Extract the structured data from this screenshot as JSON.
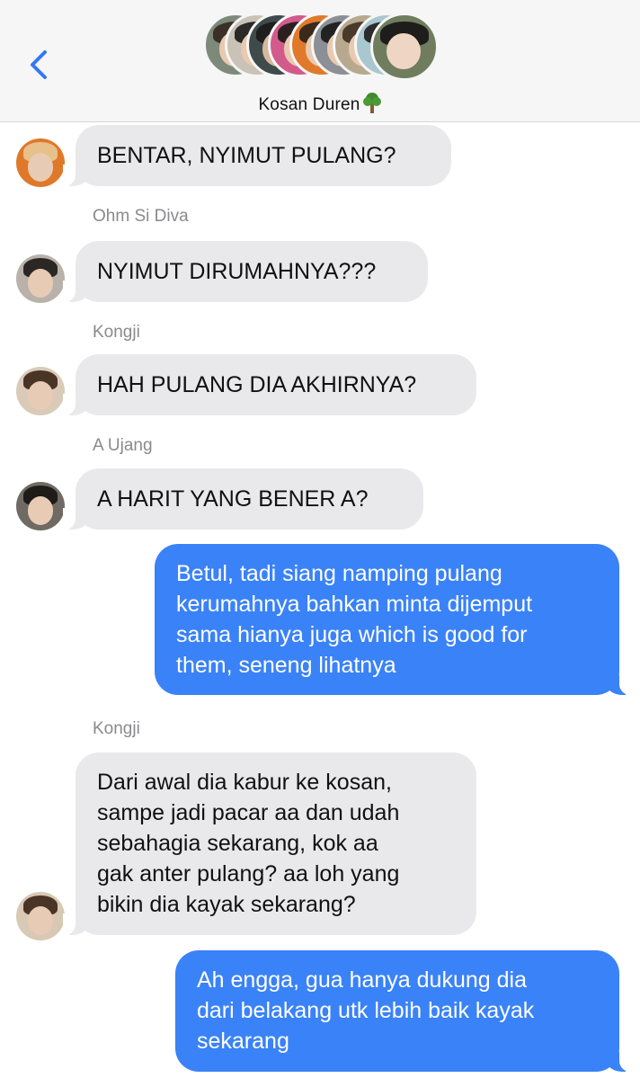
{
  "header": {
    "back_icon": "chevron-left-icon",
    "group_name": "Kosan Duren",
    "group_emoji": "tree-icon",
    "accent_color": "#3478f6"
  },
  "messages": [
    {
      "direction": "incoming",
      "sender": "",
      "text": [
        "BENTAR, NYIMUT PULANG?"
      ]
    },
    {
      "direction": "incoming",
      "sender": "Ohm Si Diva",
      "text": [
        "NYIMUT DIRUMAHNYA???"
      ]
    },
    {
      "direction": "incoming",
      "sender": "Kongji",
      "text": [
        "HAH PULANG DIA AKHIRNYA?"
      ]
    },
    {
      "direction": "incoming",
      "sender": "A Ujang",
      "text": [
        "A HARIT YANG BENER A?"
      ]
    },
    {
      "direction": "outgoing",
      "sender": "",
      "text": [
        "Betul, tadi siang namping pulang",
        "kerumahnya bahkan minta dijemput",
        "sama hianya juga which is good for",
        "them, seneng lihatnya"
      ]
    },
    {
      "direction": "incoming",
      "sender": "Kongji",
      "text": [
        "Dari awal dia kabur ke kosan,",
        "sampe jadi pacar aa dan udah",
        "sebahagia sekarang, kok aa",
        "gak anter pulang? aa loh yang",
        "bikin dia kayak sekarang?"
      ]
    },
    {
      "direction": "outgoing",
      "sender": "",
      "text": [
        "Ah engga, gua hanya dukung dia",
        "dari belakang utk lebih baik kayak",
        "sekarang"
      ]
    }
  ],
  "colors": {
    "incoming_bubble": "#e9e9eb",
    "outgoing_bubble": "#3a82f7",
    "sender_name": "#8a8a8e",
    "header_bg": "#f6f6f6"
  }
}
